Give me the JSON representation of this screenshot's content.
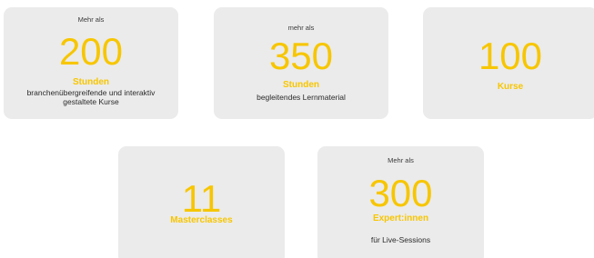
{
  "accent_color": "#f7c600",
  "card_background": "#ebebeb",
  "cards": [
    {
      "prefix": "Mehr als",
      "number": "200",
      "unit": "Stunden",
      "description": "branchenübergreifende und interaktiv gestaltete Kurse"
    },
    {
      "prefix": "mehr als",
      "number": "350",
      "unit": "Stunden",
      "description": "begleitendes Lernmaterial"
    },
    {
      "number": "100",
      "unit": "Kurse"
    },
    {
      "number": "11",
      "unit": "Masterclasses"
    },
    {
      "prefix": "Mehr als",
      "number": "300",
      "unit": "Expert:innen",
      "description": "für Live-Sessions"
    }
  ]
}
